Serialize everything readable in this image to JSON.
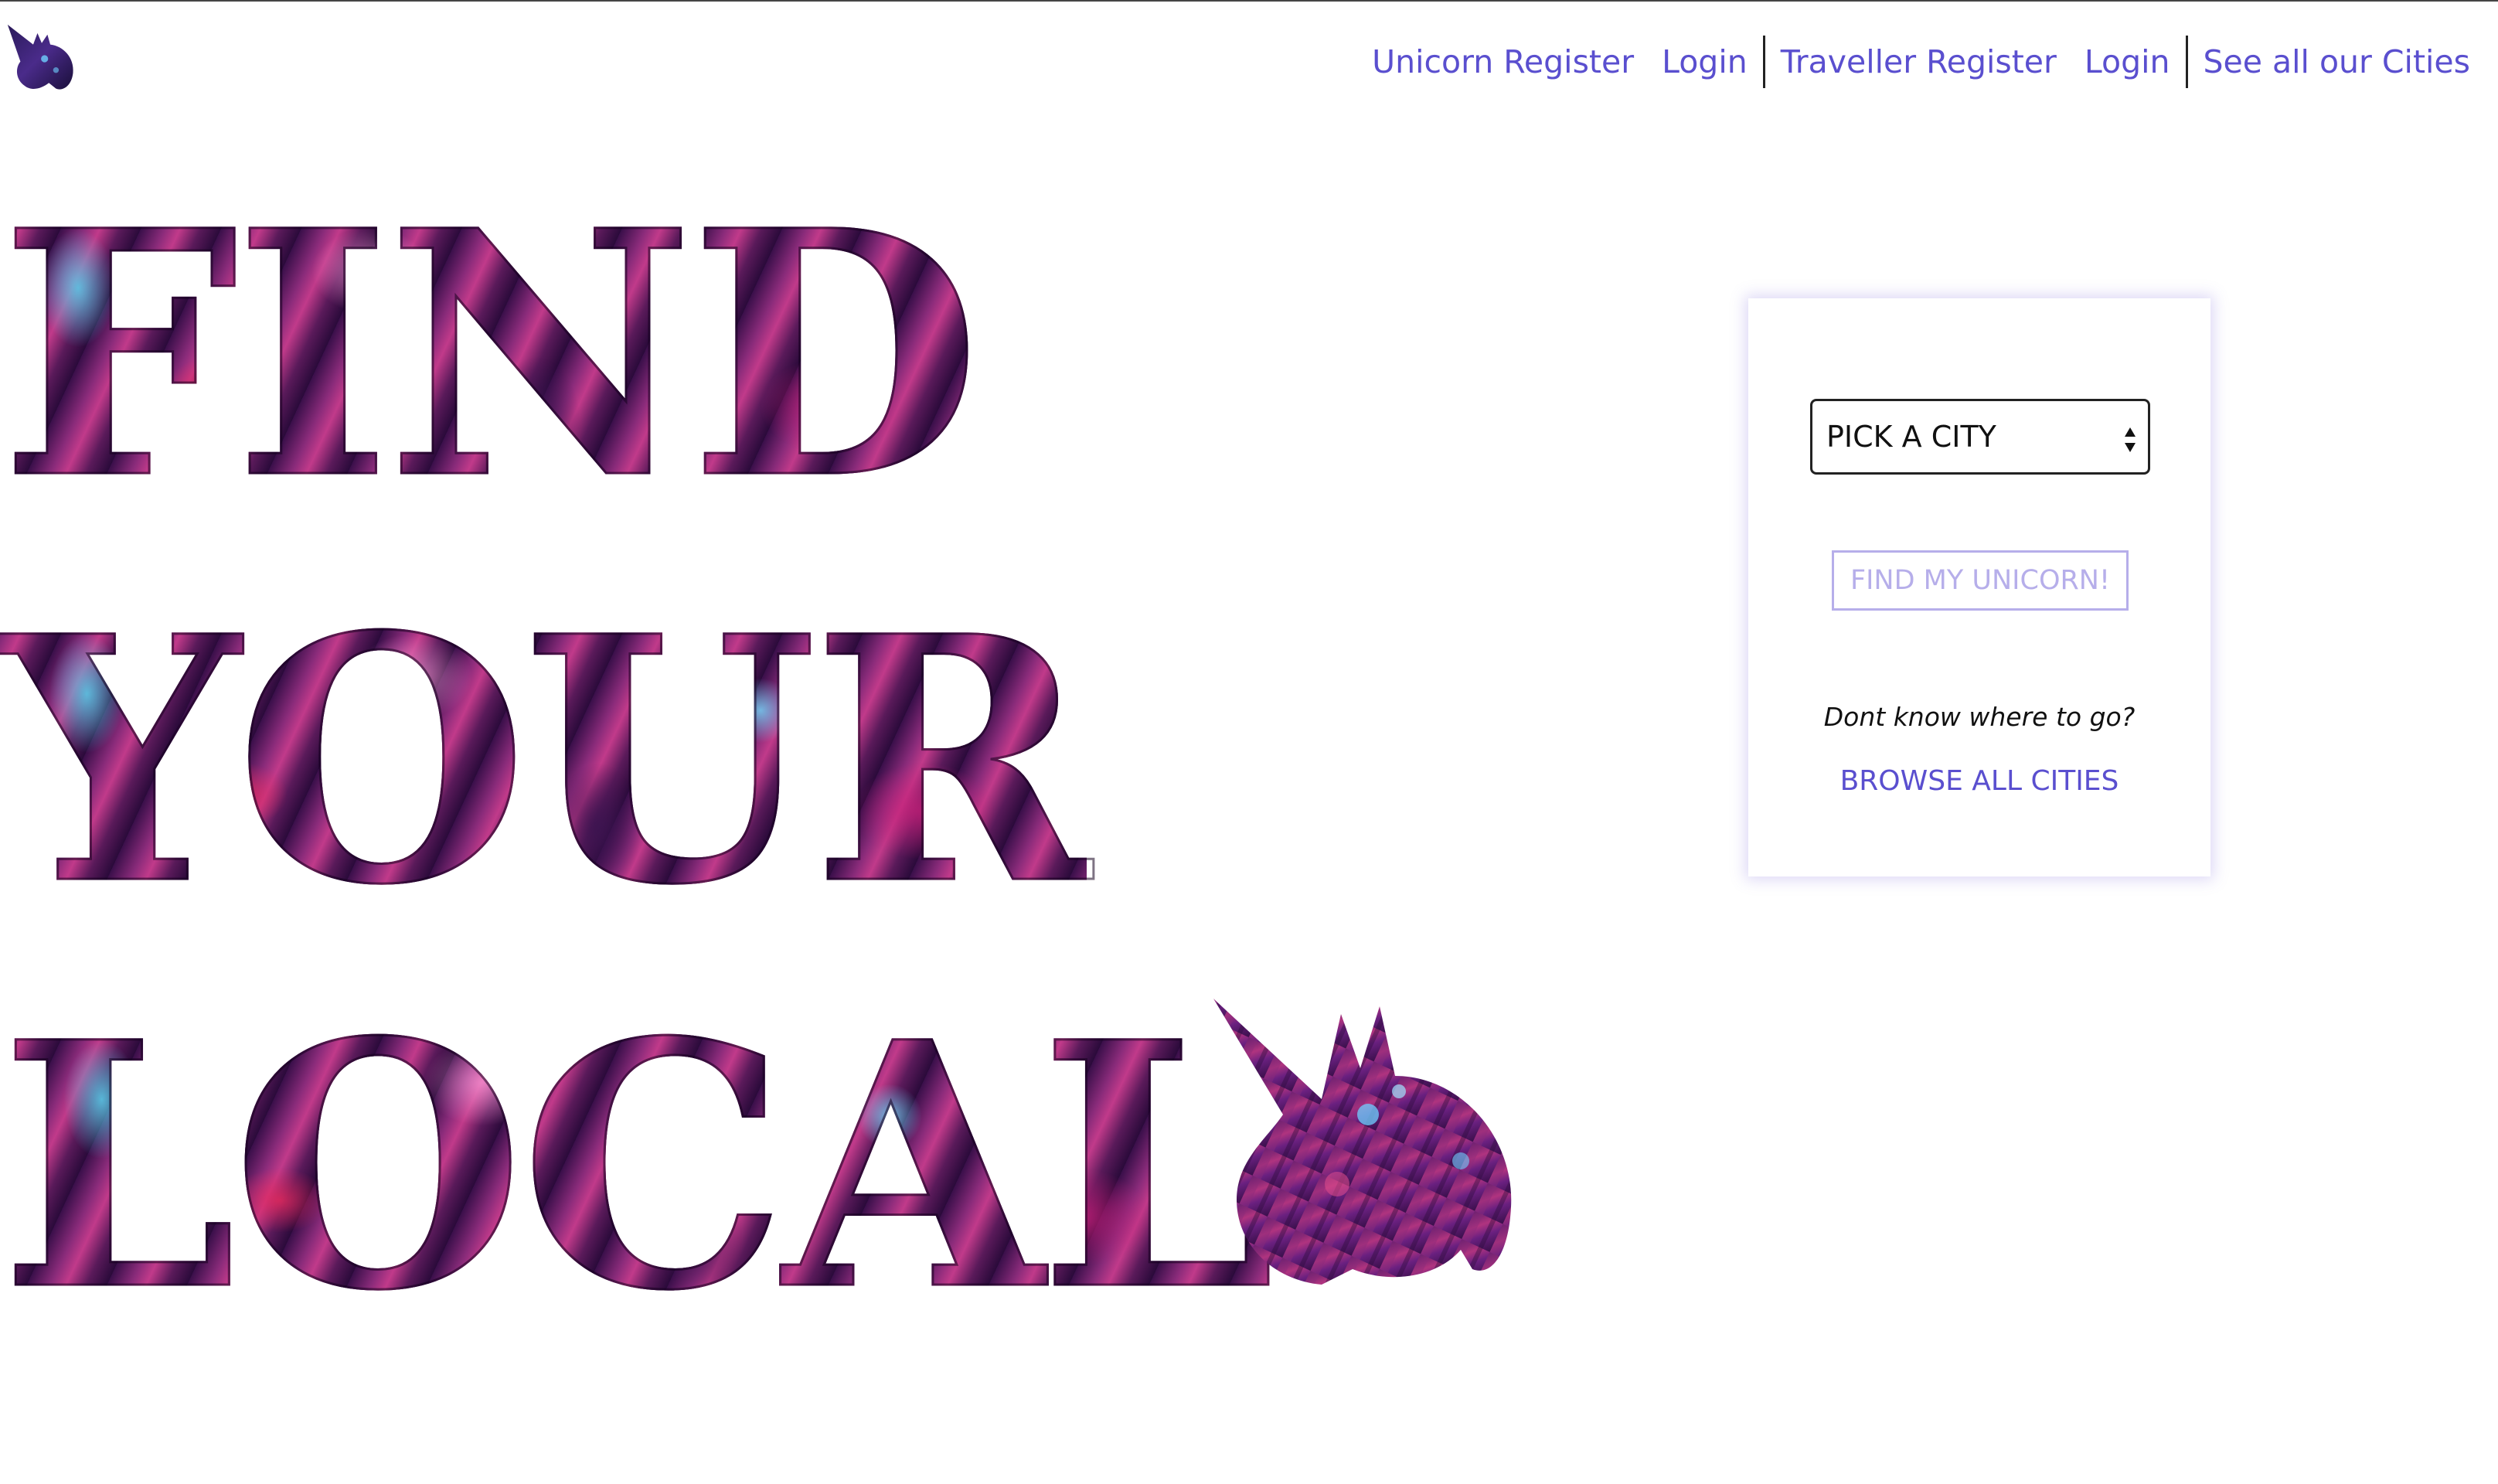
{
  "nav": {
    "items": [
      {
        "label": "Unicorn Register"
      },
      {
        "label": "Login"
      },
      {
        "label": "Traveller Register"
      },
      {
        "label": "Login"
      },
      {
        "label": "See all our Cities"
      }
    ]
  },
  "hero": {
    "line1": "FIND",
    "line2": "YOUR",
    "line3": "LOCAL"
  },
  "card": {
    "select_value": "PICK A CITY",
    "find_button": "FIND MY UNICORN!",
    "prompt": "Dont know where to go?",
    "browse_link": "BROWSE ALL CITIES"
  },
  "colors": {
    "link": "#5a4fcf",
    "button_disabled": "#b6aeea",
    "hero_fill": "#8a2b7a"
  },
  "icons": {
    "logo": "unicorn-head-icon",
    "hero_unicorn": "unicorn-head-icon",
    "select_arrows": "updown-arrows-icon"
  }
}
